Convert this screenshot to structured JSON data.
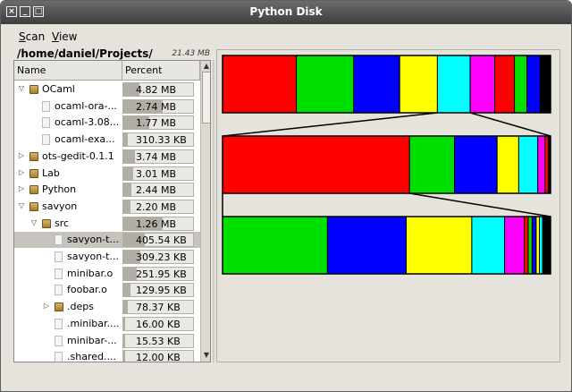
{
  "window": {
    "title": "Python Disk"
  },
  "menu": [
    {
      "accel": "S",
      "rest": "can"
    },
    {
      "accel": "V",
      "rest": "iew"
    }
  ],
  "path": {
    "text": "/home/daniel/Projects/",
    "size": "21.43 MB"
  },
  "columns": {
    "name": "Name",
    "percent": "Percent"
  },
  "rows": [
    {
      "name": "OCaml",
      "size": "4.82 MB",
      "fraction": 0.23,
      "depth": 0,
      "kind": "folder",
      "expander": "open"
    },
    {
      "name": "ocaml-ora-...",
      "size": "2.74 MB",
      "fraction": 0.57,
      "depth": 1,
      "kind": "file",
      "expander": "none"
    },
    {
      "name": "ocaml-3.08...",
      "size": "1.77 MB",
      "fraction": 0.37,
      "depth": 1,
      "kind": "file",
      "expander": "none"
    },
    {
      "name": "ocaml-exa...",
      "size": "310.33 KB",
      "fraction": 0.06,
      "depth": 1,
      "kind": "file",
      "expander": "none"
    },
    {
      "name": "ots-gedit-0.1.1",
      "size": "3.74 MB",
      "fraction": 0.17,
      "depth": 0,
      "kind": "folder",
      "expander": "closed"
    },
    {
      "name": "Lab",
      "size": "3.01 MB",
      "fraction": 0.14,
      "depth": 0,
      "kind": "folder",
      "expander": "closed"
    },
    {
      "name": "Python",
      "size": "2.44 MB",
      "fraction": 0.11,
      "depth": 0,
      "kind": "folder",
      "expander": "closed"
    },
    {
      "name": "savyon",
      "size": "2.20 MB",
      "fraction": 0.1,
      "depth": 0,
      "kind": "folder",
      "expander": "open"
    },
    {
      "name": "src",
      "size": "1.26 MB",
      "fraction": 0.57,
      "depth": 1,
      "kind": "folder",
      "expander": "open"
    },
    {
      "name": "savyon-t...",
      "size": "405.54 KB",
      "fraction": 0.31,
      "depth": 2,
      "kind": "file",
      "expander": "none",
      "selected": true
    },
    {
      "name": "savyon-t...",
      "size": "309.23 KB",
      "fraction": 0.24,
      "depth": 2,
      "kind": "file",
      "expander": "none"
    },
    {
      "name": "minibar.o",
      "size": "251.95 KB",
      "fraction": 0.19,
      "depth": 2,
      "kind": "file",
      "expander": "none"
    },
    {
      "name": "foobar.o",
      "size": "129.95 KB",
      "fraction": 0.1,
      "depth": 2,
      "kind": "file",
      "expander": "none"
    },
    {
      "name": ".deps",
      "size": "78.37 KB",
      "fraction": 0.06,
      "depth": 2,
      "kind": "folder",
      "expander": "closed"
    },
    {
      "name": ".minibar....",
      "size": "16.00 KB",
      "fraction": 0.01,
      "depth": 2,
      "kind": "file",
      "expander": "none"
    },
    {
      "name": "minibar-...",
      "size": "15.53 KB",
      "fraction": 0.01,
      "depth": 2,
      "kind": "file",
      "expander": "none"
    },
    {
      "name": ".shared....",
      "size": "12.00 KB",
      "fraction": 0.01,
      "depth": 2,
      "kind": "file",
      "expander": "none"
    }
  ],
  "usage_bars": [
    {
      "segments": [
        {
          "color": "#ff0000",
          "fraction": 0.225
        },
        {
          "color": "#00e000",
          "fraction": 0.175
        },
        {
          "color": "#0000ff",
          "fraction": 0.14
        },
        {
          "color": "#ffff00",
          "fraction": 0.115
        },
        {
          "color": "#00ffff",
          "fraction": 0.1
        },
        {
          "color": "#ff00ff",
          "fraction": 0.075
        },
        {
          "color": "#ff0000",
          "fraction": 0.06
        },
        {
          "color": "#00e000",
          "fraction": 0.038
        },
        {
          "color": "#0000ff",
          "fraction": 0.04
        },
        {
          "color": "#000000",
          "fraction": 0.032
        }
      ]
    },
    {
      "segments": [
        {
          "color": "#ff0000",
          "fraction": 0.57
        },
        {
          "color": "#00e000",
          "fraction": 0.137
        },
        {
          "color": "#0000ff",
          "fraction": 0.13
        },
        {
          "color": "#ffff00",
          "fraction": 0.066
        },
        {
          "color": "#00ffff",
          "fraction": 0.058
        },
        {
          "color": "#ff00ff",
          "fraction": 0.022
        },
        {
          "color": "#ff0000",
          "fraction": 0.01
        },
        {
          "color": "#000000",
          "fraction": 0.007
        }
      ]
    },
    {
      "segments": [
        {
          "color": "#00e000",
          "fraction": 0.32
        },
        {
          "color": "#0000ff",
          "fraction": 0.24
        },
        {
          "color": "#ffff00",
          "fraction": 0.2
        },
        {
          "color": "#00ffff",
          "fraction": 0.1
        },
        {
          "color": "#ff00ff",
          "fraction": 0.06
        },
        {
          "color": "#ff0000",
          "fraction": 0.012
        },
        {
          "color": "#00e000",
          "fraction": 0.012
        },
        {
          "color": "#0000ff",
          "fraction": 0.012
        },
        {
          "color": "#ffff00",
          "fraction": 0.01
        },
        {
          "color": "#00ffff",
          "fraction": 0.01
        },
        {
          "color": "#000000",
          "fraction": 0.024
        }
      ]
    }
  ],
  "icons": {
    "expander_open": "triangle-down-icon",
    "expander_closed": "triangle-right-icon",
    "folder": "folder-icon",
    "file": "file-icon"
  }
}
